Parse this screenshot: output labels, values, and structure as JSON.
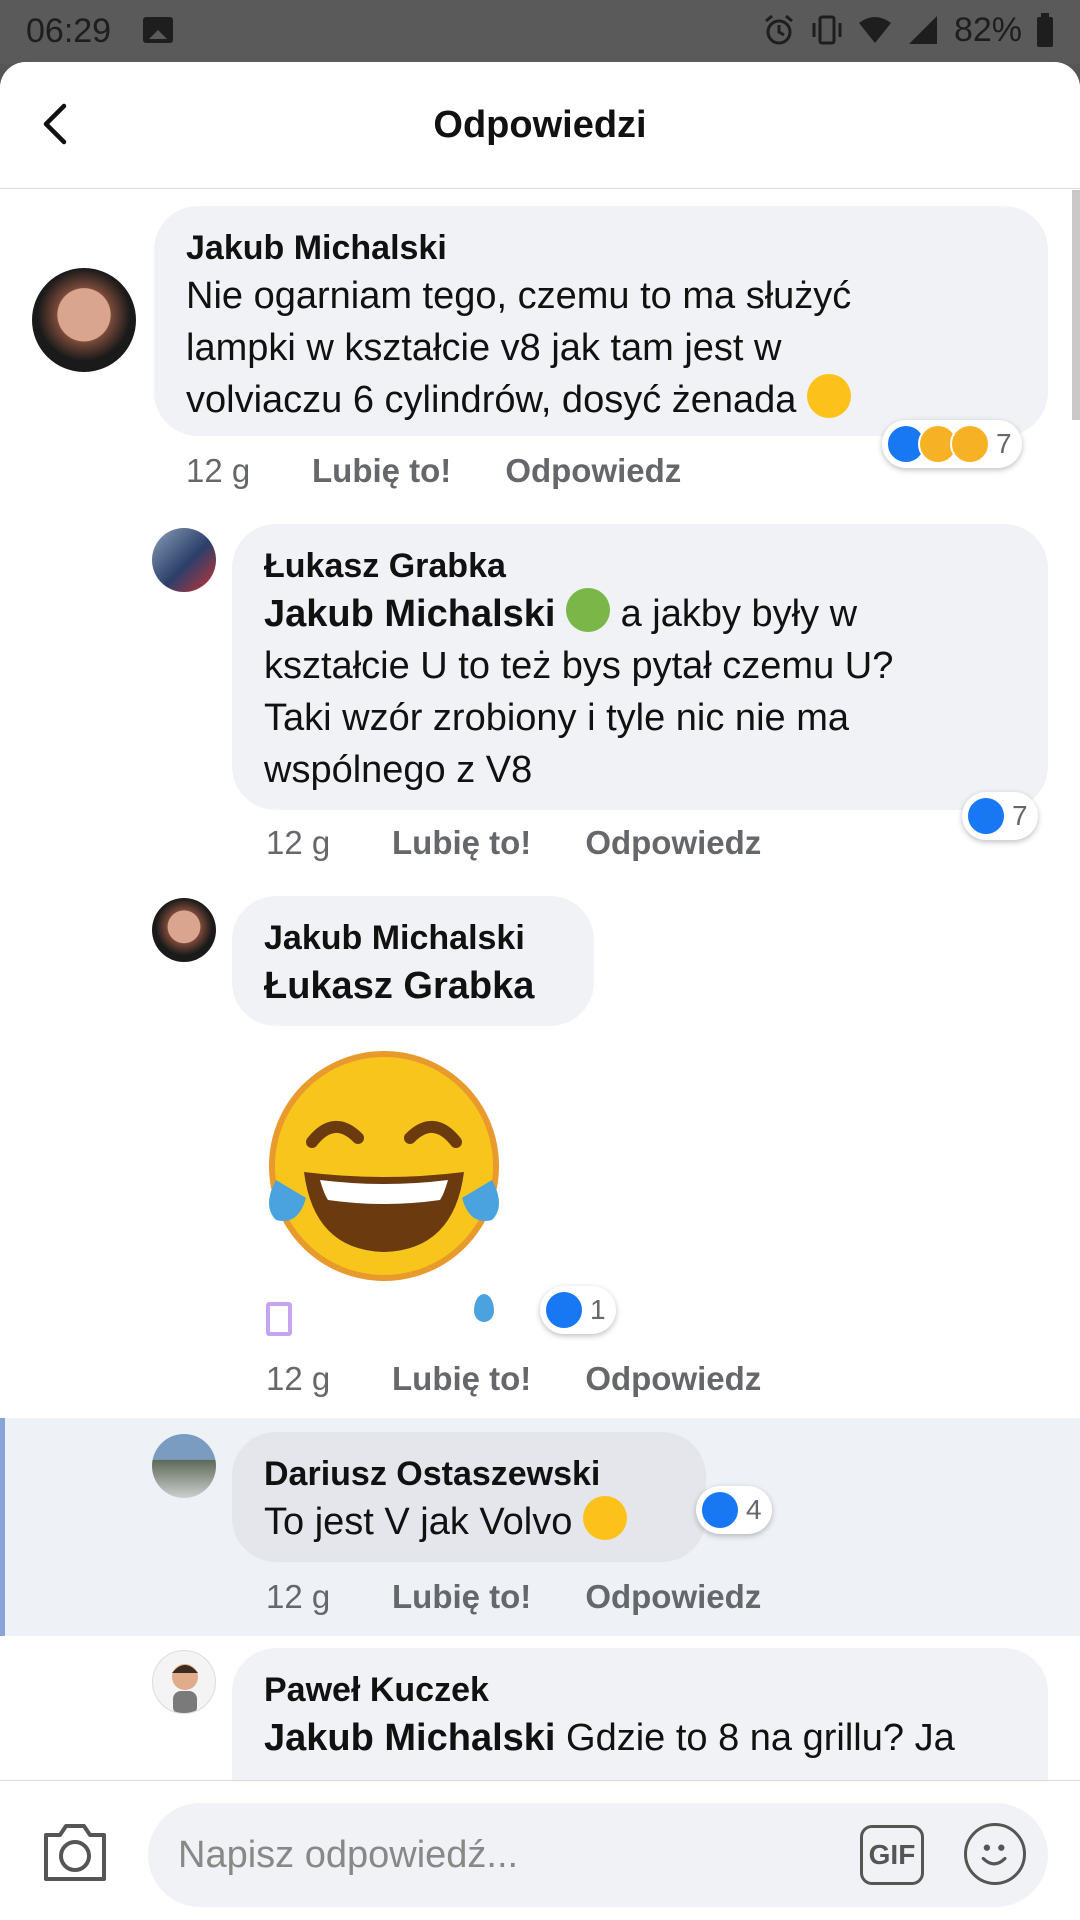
{
  "status_bar": {
    "time": "06:29",
    "battery": "82%"
  },
  "header": {
    "title": "Odpowiedzi"
  },
  "comments": [
    {
      "author": "Jakub Michalski",
      "lines": [
        "Nie ogarniam tego, czemu to ma służyć",
        "lampki w kształcie v8 jak tam jest w",
        "volviaczu 6 cylindrów, dosyć żenada"
      ],
      "time": "12 g",
      "like": "Lubię to!",
      "reply": "Odpowiedz",
      "reaction_count": "7"
    },
    {
      "author": "Łukasz Grabka",
      "mention": "Jakub Michalski",
      "lines": [
        "a jakby były w",
        "kształcie U to też bys pytał czemu U?",
        "Taki wzór zrobiony i tyle nic nie ma",
        "wspólnego z V8"
      ],
      "time": "12 g",
      "like": "Lubię to!",
      "reply": "Odpowiedz",
      "reaction_count": "7"
    },
    {
      "author": "Jakub Michalski",
      "mention": "Łukasz Grabka",
      "time": "12 g",
      "like": "Lubię to!",
      "reply": "Odpowiedz",
      "reaction_count": "1"
    },
    {
      "author": "Dariusz Ostaszewski",
      "lines": [
        "To jest V jak Volvo"
      ],
      "time": "12 g",
      "like": "Lubię to!",
      "reply": "Odpowiedz",
      "reaction_count": "4"
    },
    {
      "author": "Paweł Kuczek",
      "mention": "Jakub Michalski",
      "lines": [
        "Gdzie to 8 na grillu? Ja"
      ]
    }
  ],
  "composer": {
    "placeholder": "Napisz odpowiedź...",
    "gif_label": "GIF"
  },
  "colors": {
    "like_blue": "#1877f2",
    "bubble": "#f0f2f5",
    "meta": "#65676b"
  }
}
